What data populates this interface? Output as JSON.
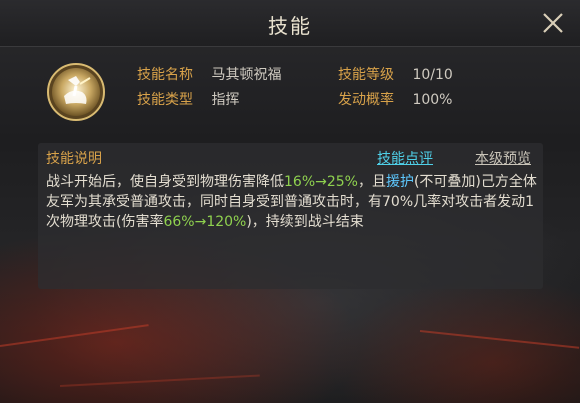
{
  "header": {
    "title": "技能"
  },
  "skill": {
    "name_label": "技能名称",
    "name_value": "马其顿祝福",
    "type_label": "技能类型",
    "type_value": "指挥",
    "level_label": "技能等级",
    "level_value": "10/10",
    "chance_label": "发动概率",
    "chance_value": "100%"
  },
  "description": {
    "label": "技能说明",
    "review_link": "技能点评",
    "preview_link": "本级预览",
    "parts": {
      "p1": "战斗开始后，使自身受到物理伤害降低",
      "p2": "16%→25%",
      "p3": "，且",
      "p4": "援护",
      "p5": "(不可叠加)己方全体友军为其承受普通攻击，同时自身受到普通攻击时，有70%几率对攻击者发动1次物理攻击(伤害率",
      "p6": "66%→120%",
      "p7": ")，持续到战斗结束"
    }
  },
  "colors": {
    "label_gold": "#d8a24a",
    "value_text": "#cfcac0",
    "highlight_green": "#8fd14f",
    "highlight_blue": "#5ec9ff",
    "link_cyan": "#4fd0e8"
  },
  "icons": {
    "close": "close-x-icon",
    "skill": "skill-emblem-icon"
  }
}
